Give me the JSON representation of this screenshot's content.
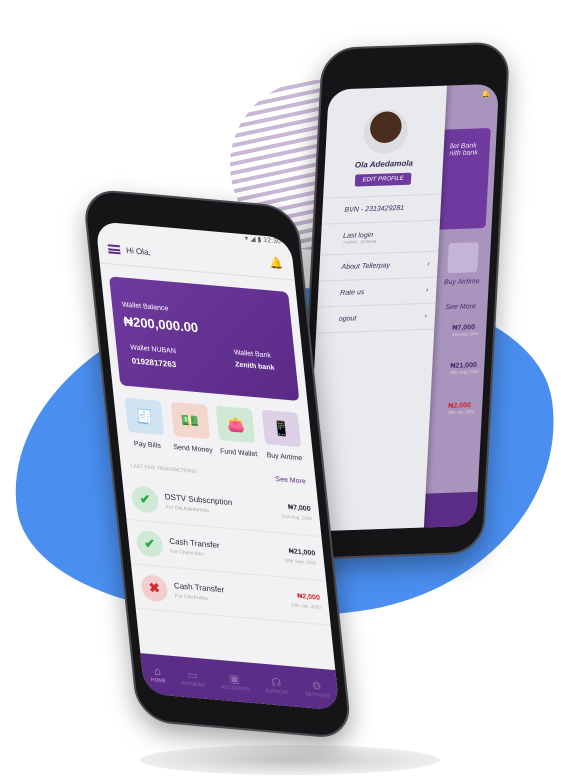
{
  "back_phone": {
    "drawer": {
      "name": "Ola Adedamola",
      "edit_profile": "EDIT PROFILE",
      "bvn": "BVN - 2313429281",
      "last_login": "Last login",
      "last_login_time": "7:00PM - 10:30AM",
      "items": [
        {
          "label": "About Tellerpay"
        },
        {
          "label": "Rate us"
        },
        {
          "label": "ogout"
        }
      ]
    },
    "peek": {
      "wallet_bank": "llet Bank",
      "bank": "nith bank",
      "buy_airtime": "Buy Airtime",
      "see_more": "See More",
      "amounts": [
        {
          "amount": "₦7,000",
          "date": "21st Aug, 2020"
        },
        {
          "amount": "₦21,000",
          "date": "20th Sept, 2020"
        },
        {
          "amount": "₦2,000",
          "date": "20th Jan, 2020"
        }
      ]
    }
  },
  "front_phone": {
    "status_time": "12:30",
    "greeting": "Hi Ola,",
    "card": {
      "balance_label": "Wallet Balance",
      "balance": "₦200,000.00",
      "bank_label": "Wallet Bank",
      "bank": "Zenith bank",
      "nuban_label": "Wallet NUBAN",
      "nuban": "0192817263"
    },
    "actions": [
      {
        "label": "Pay Bills",
        "icon": "receipt-icon",
        "bg": "#cfe3f2",
        "color": "#3a8fd0"
      },
      {
        "label": "Send Money",
        "icon": "money-icon",
        "bg": "#f3d6cc",
        "color": "#e0553a"
      },
      {
        "label": "Fund Wallet",
        "icon": "wallet-icon",
        "bg": "#cfe9d6",
        "color": "#2aa84a"
      },
      {
        "label": "Buy Airtime",
        "icon": "phone-icon",
        "bg": "#ddd0e6",
        "color": "#6f3a9f"
      }
    ],
    "section_label": "LAST FIVE TRANSACTIONS",
    "see_more": "See More",
    "transactions": [
      {
        "title": "DSTV Subscription",
        "sub": "For Ola Adedamola",
        "amount": "₦7,000",
        "date": "21st Aug, 2020",
        "status": "success"
      },
      {
        "title": "Cash Transfer",
        "sub": "For Chichi Alex",
        "amount": "₦21,000",
        "date": "20th Sept, 2020",
        "status": "success"
      },
      {
        "title": "Cash Transfer",
        "sub": "For Chichi Alex",
        "amount": "₦2,000",
        "date": "20th Jan, 2020",
        "status": "failed"
      }
    ],
    "nav": [
      {
        "label": "HOME"
      },
      {
        "label": "PAYMENT"
      },
      {
        "label": "ACCOUNTS"
      },
      {
        "label": "SUPPORT"
      },
      {
        "label": "SETTINGS"
      }
    ]
  },
  "colors": {
    "brand": "#5b2d86",
    "accent_blue": "#4a8ff0",
    "success": "#2aa84a",
    "error": "#d8262d"
  }
}
